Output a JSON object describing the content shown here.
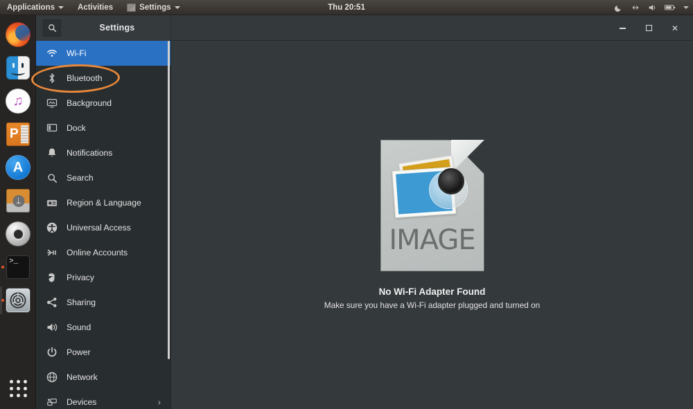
{
  "topbar": {
    "applications_label": "Applications",
    "activities_label": "Activities",
    "settings_label": "Settings",
    "clock": "Thu 20:51",
    "tray": [
      {
        "name": "night-light-icon",
        "glyph": "☾"
      },
      {
        "name": "network-icon",
        "glyph": "↔"
      },
      {
        "name": "volume-icon",
        "glyph": "🔊"
      },
      {
        "name": "battery-icon",
        "glyph": ""
      },
      {
        "name": "system-menu-caret-icon",
        "glyph": "▾"
      }
    ]
  },
  "dock": {
    "items": [
      {
        "name": "firefox",
        "label": "Firefox",
        "running": false
      },
      {
        "name": "files",
        "label": "Files",
        "running": false
      },
      {
        "name": "music",
        "label": "Music",
        "running": false,
        "glyph": "♫"
      },
      {
        "name": "powerpoint",
        "label": "Presentation",
        "running": false,
        "letter": "P"
      },
      {
        "name": "app-store",
        "label": "Software",
        "running": false,
        "letter": "A"
      },
      {
        "name": "bluetooth-drive",
        "label": "Bluetooth Drive",
        "running": false,
        "glyph": "ᛦ"
      },
      {
        "name": "help",
        "label": "Help",
        "running": false
      },
      {
        "name": "terminal",
        "label": "Terminal",
        "running": true,
        "glyph": ">_"
      },
      {
        "name": "settings",
        "label": "Settings",
        "running": true,
        "active": true
      }
    ],
    "show_apps_label": "Show Applications"
  },
  "window": {
    "title": "Settings",
    "search_icon": "search-icon",
    "controls": {
      "minimize": "minimize-button",
      "maximize": "maximize-button",
      "close_glyph": "✕"
    }
  },
  "sidebar": {
    "items": [
      {
        "label": "Wi-Fi",
        "icon": "wifi-icon",
        "selected": true,
        "chevron": false
      },
      {
        "label": "Bluetooth",
        "icon": "bluetooth-icon",
        "selected": false,
        "chevron": false
      },
      {
        "label": "Background",
        "icon": "background-icon",
        "selected": false,
        "chevron": false
      },
      {
        "label": "Dock",
        "icon": "dock-icon",
        "selected": false,
        "chevron": false
      },
      {
        "label": "Notifications",
        "icon": "bell-icon",
        "selected": false,
        "chevron": false
      },
      {
        "label": "Search",
        "icon": "search-icon",
        "selected": false,
        "chevron": false
      },
      {
        "label": "Region & Language",
        "icon": "region-language-icon",
        "selected": false,
        "chevron": false
      },
      {
        "label": "Universal Access",
        "icon": "universal-access-icon",
        "selected": false,
        "chevron": false
      },
      {
        "label": "Online Accounts",
        "icon": "online-accounts-icon",
        "selected": false,
        "chevron": false
      },
      {
        "label": "Privacy",
        "icon": "privacy-hand-icon",
        "selected": false,
        "chevron": false
      },
      {
        "label": "Sharing",
        "icon": "sharing-icon",
        "selected": false,
        "chevron": false
      },
      {
        "label": "Sound",
        "icon": "sound-icon",
        "selected": false,
        "chevron": false
      },
      {
        "label": "Power",
        "icon": "power-icon",
        "selected": false,
        "chevron": false
      },
      {
        "label": "Network",
        "icon": "network-icon",
        "selected": false,
        "chevron": false
      },
      {
        "label": "Devices",
        "icon": "devices-icon",
        "selected": false,
        "chevron": true
      }
    ]
  },
  "content": {
    "placeholder_label": "IMAGE",
    "title": "No Wi-Fi Adapter Found",
    "subtitle": "Make sure you have a Wi-Fi adapter plugged and turned on"
  },
  "annotation": {
    "name": "bluetooth-highlight-ellipse",
    "color": "#e8883a",
    "targets": "Bluetooth"
  },
  "colors": {
    "accent_selected": "#2a71c4",
    "highlight": "#e8883a",
    "sidebar_bg": "#282d2f",
    "content_bg": "#34393c",
    "topbar_bg": "#3c3834",
    "dock_bg": "#262523"
  }
}
